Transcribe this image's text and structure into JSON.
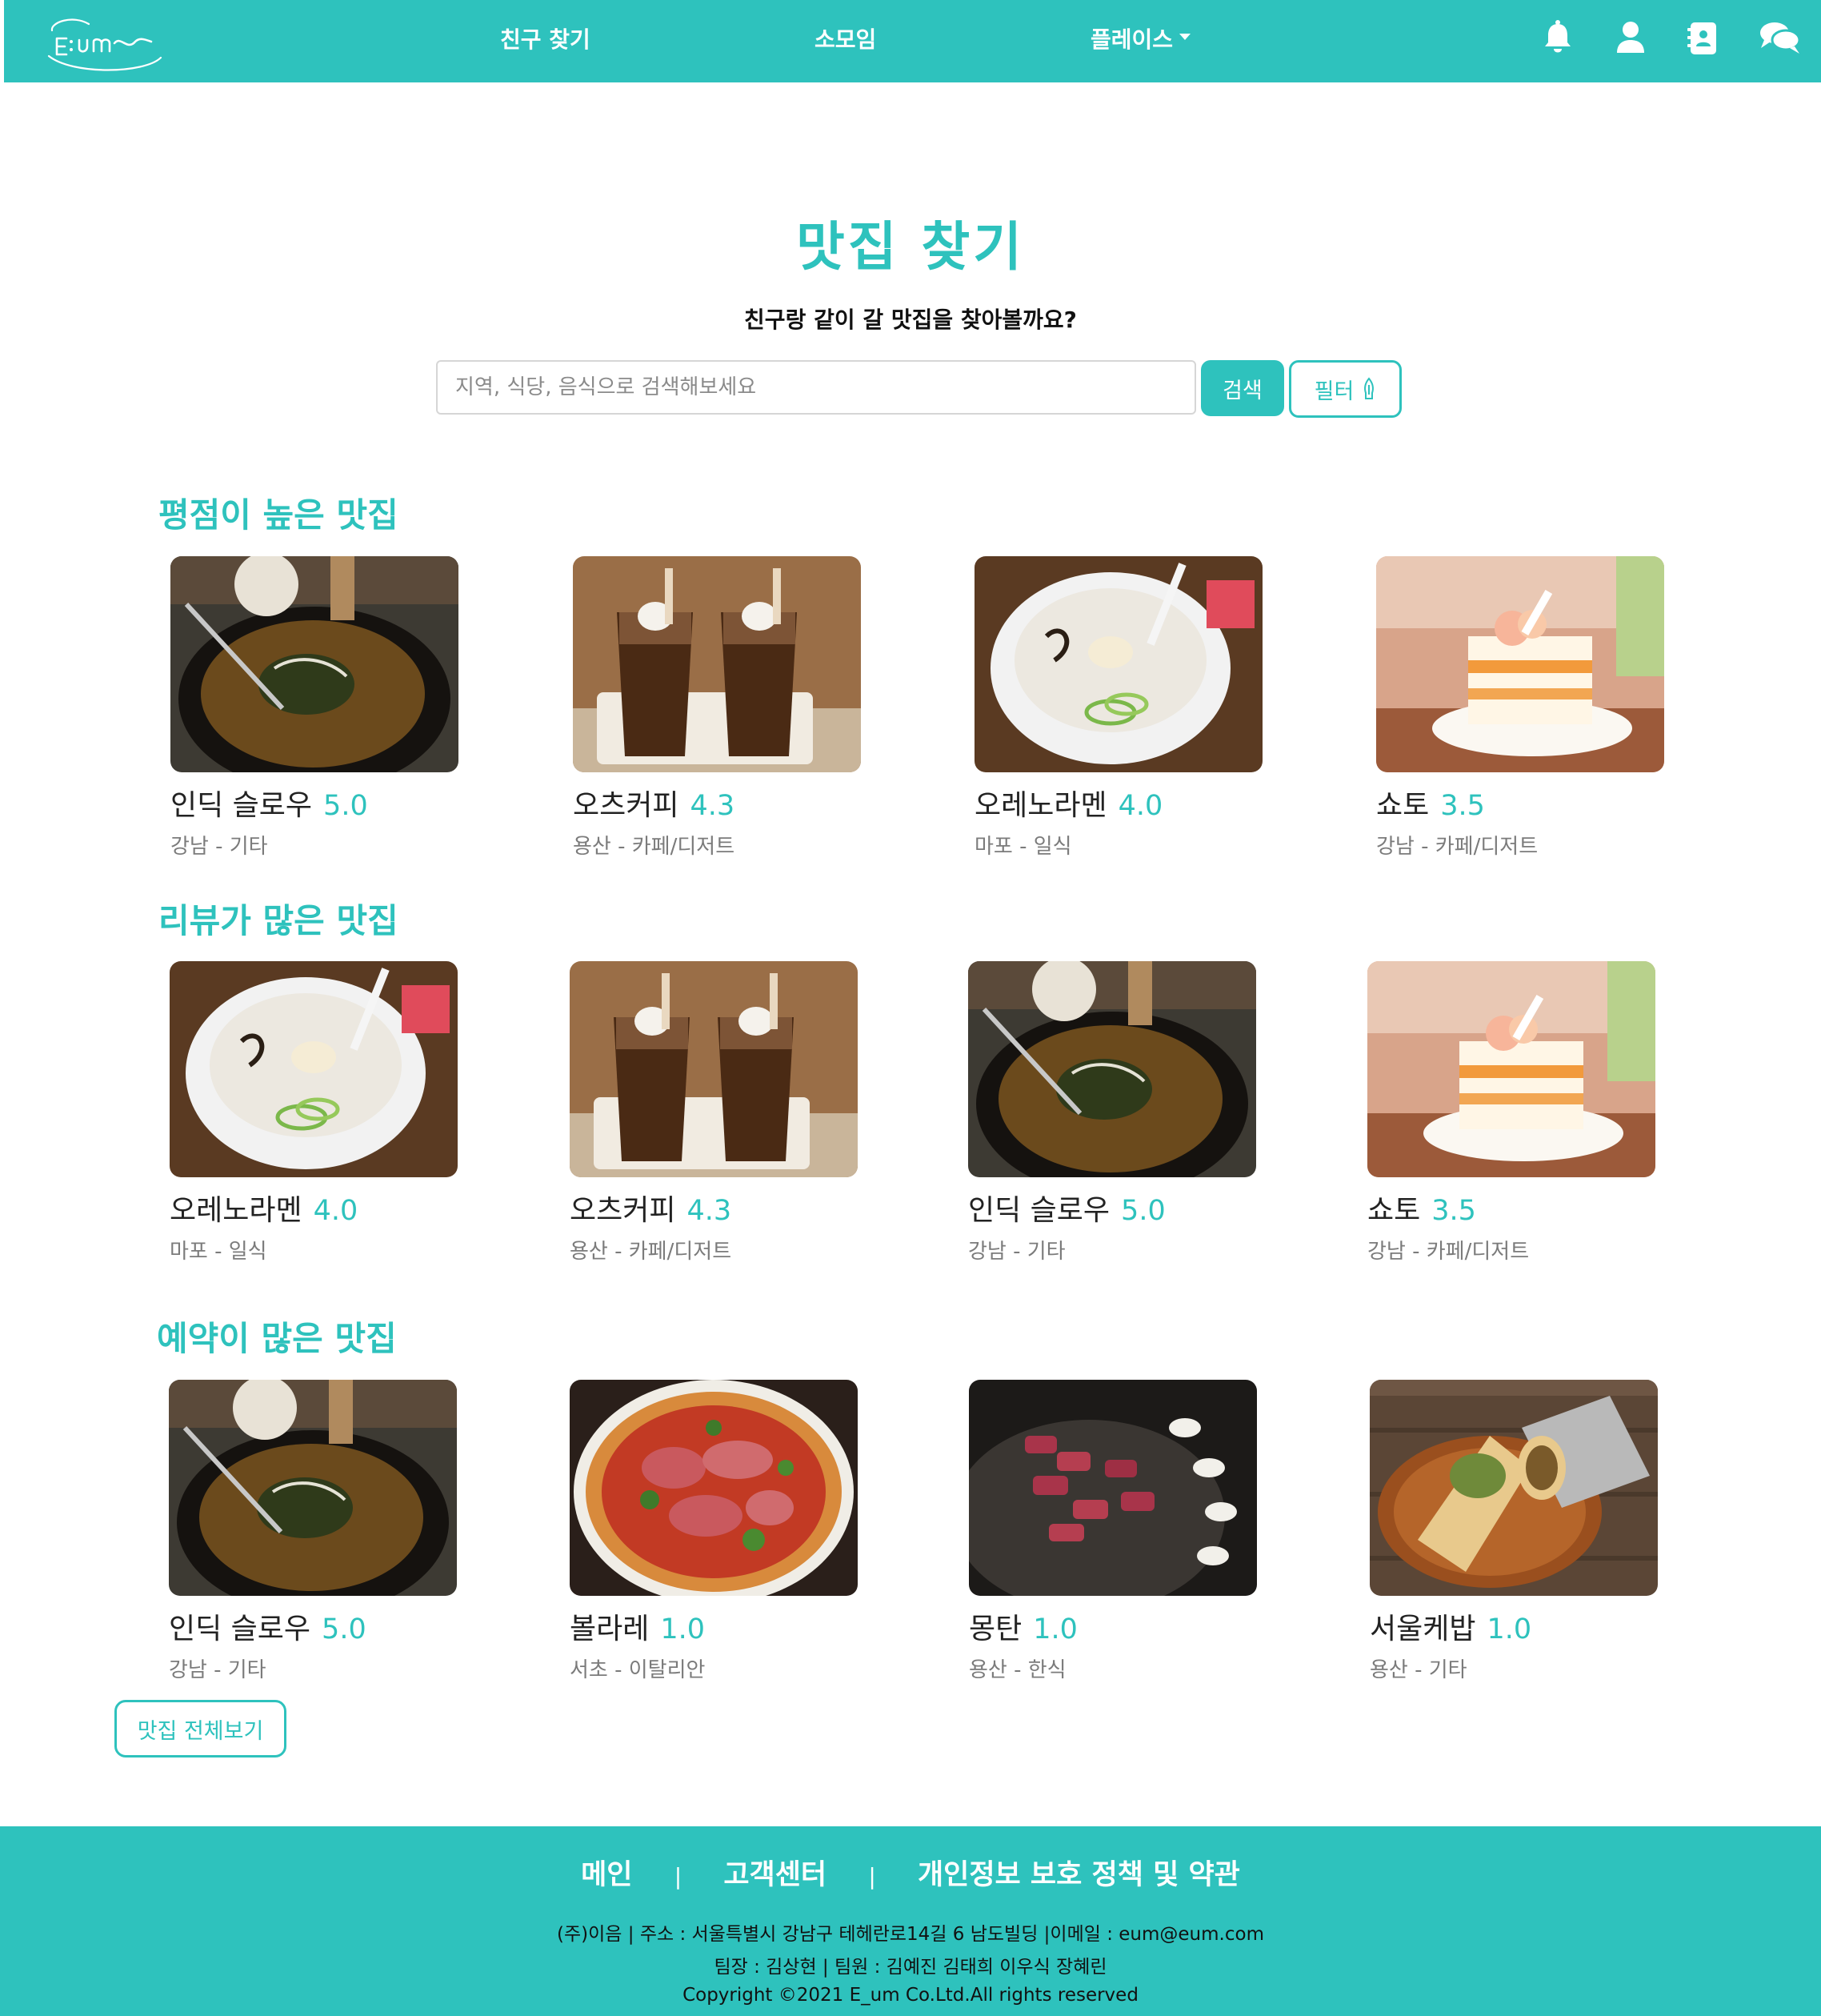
{
  "header": {
    "logo_text": "E:um~",
    "nav": [
      {
        "label": "친구 찾기"
      },
      {
        "label": "소모임"
      },
      {
        "label": "플레이스"
      }
    ],
    "icons": [
      "bell-icon",
      "user-icon",
      "contact-book-icon",
      "chat-icon"
    ]
  },
  "hero": {
    "title": "맛집 찾기",
    "subtitle": "친구랑 같이 갈 맛집을 찾아볼까요?",
    "search_placeholder": "지역, 식당, 음식으로 검색해보세요",
    "search_button": "검색",
    "filter_button": "필터"
  },
  "sections": [
    {
      "title": "평점이 높은 맛집",
      "cards": [
        {
          "name": "인딕 슬로우",
          "rating": "5.0",
          "meta": "강남 - 기타",
          "image": "curry"
        },
        {
          "name": "오츠커피",
          "rating": "4.3",
          "meta": "용산 - 카페/디저트",
          "image": "coffee"
        },
        {
          "name": "오레노라멘",
          "rating": "4.0",
          "meta": "마포 - 일식",
          "image": "ramen"
        },
        {
          "name": "쇼토",
          "rating": "3.5",
          "meta": "강남 - 카페/디저트",
          "image": "cake"
        }
      ]
    },
    {
      "title": "리뷰가 많은 맛집",
      "cards": [
        {
          "name": "오레노라멘",
          "rating": "4.0",
          "meta": "마포 - 일식",
          "image": "ramen"
        },
        {
          "name": "오츠커피",
          "rating": "4.3",
          "meta": "용산 - 카페/디저트",
          "image": "coffee"
        },
        {
          "name": "인딕 슬로우",
          "rating": "5.0",
          "meta": "강남 - 기타",
          "image": "curry"
        },
        {
          "name": "쇼토",
          "rating": "3.5",
          "meta": "강남 - 카페/디저트",
          "image": "cake"
        }
      ]
    },
    {
      "title": "예약이 많은 맛집",
      "cards": [
        {
          "name": "인딕 슬로우",
          "rating": "5.0",
          "meta": "강남 - 기타",
          "image": "curry"
        },
        {
          "name": "볼라레",
          "rating": "1.0",
          "meta": "서초 - 이탈리안",
          "image": "pizza"
        },
        {
          "name": "몽탄",
          "rating": "1.0",
          "meta": "용산 - 한식",
          "image": "bbq"
        },
        {
          "name": "서울케밥",
          "rating": "1.0",
          "meta": "용산 - 기타",
          "image": "kebab"
        }
      ]
    }
  ],
  "all_button": "맛집 전체보기",
  "footer": {
    "links": [
      "메인",
      "고객센터",
      "개인정보 보호 정책 및 약관"
    ],
    "separator": "|",
    "address": "(주)이음 | 주소 : 서울특별시 강남구 테헤란로14길 6 남도빌딩 |이메일 : eum@eum.com",
    "team": "팀장 : 김상현 | 팀원 : 김예진 김태희 이우식 장혜린",
    "copyright": "Copyright ©2021 E_um Co.Ltd.All rights reserved"
  },
  "colors": {
    "accent": "#2ec2bd",
    "text": "#222222",
    "meta": "#7b7b7b"
  }
}
